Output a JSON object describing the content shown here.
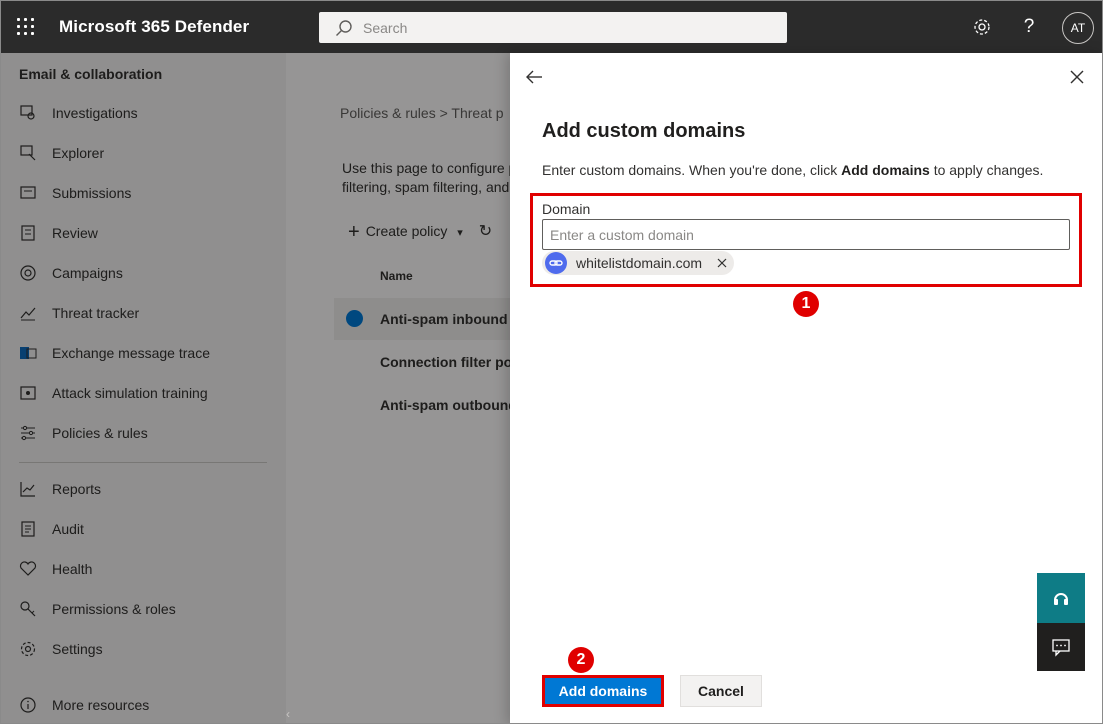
{
  "app": {
    "title": "Microsoft 365 Defender",
    "user_initials": "AT"
  },
  "search": {
    "placeholder": "Search"
  },
  "topbar_icons": [
    "waffle-icon",
    "gear-icon",
    "help-icon"
  ],
  "sidebar": {
    "section": "Email & collaboration",
    "items": [
      {
        "label": "Investigations",
        "icon": "investigations-icon"
      },
      {
        "label": "Explorer",
        "icon": "explorer-icon"
      },
      {
        "label": "Submissions",
        "icon": "submissions-icon"
      },
      {
        "label": "Review",
        "icon": "review-icon"
      },
      {
        "label": "Campaigns",
        "icon": "campaigns-icon"
      },
      {
        "label": "Threat tracker",
        "icon": "threat-tracker-icon"
      },
      {
        "label": "Exchange message trace",
        "icon": "exchange-icon"
      },
      {
        "label": "Attack simulation training",
        "icon": "attack-simulation-icon"
      },
      {
        "label": "Policies & rules",
        "icon": "policies-icon"
      },
      {
        "label": "Reports",
        "icon": "reports-icon"
      },
      {
        "label": "Audit",
        "icon": "audit-icon"
      },
      {
        "label": "Health",
        "icon": "health-icon"
      },
      {
        "label": "Permissions & roles",
        "icon": "permissions-icon"
      },
      {
        "label": "Settings",
        "icon": "settings-icon"
      },
      {
        "label": "More resources",
        "icon": "info-icon"
      }
    ]
  },
  "background": {
    "breadcrumb": "Policies & rules  >  Threat p",
    "description_line1": "Use this page to configure p",
    "description_line2": "filtering, spam filtering, and",
    "create_policy": "Create policy",
    "column_name": "Name",
    "rows": [
      "Anti-spam inbound p",
      "Connection filter pol",
      "Anti-spam outbound"
    ]
  },
  "panel": {
    "title": "Add custom domains",
    "desc_prefix": "Enter custom domains. When you're done, click ",
    "desc_bold": "Add domains",
    "desc_suffix": " to apply changes.",
    "field_label": "Domain",
    "field_placeholder": "Enter a custom domain",
    "field_value": "",
    "chip_text": "whitelistdomain.com",
    "badge1": "1",
    "badge2": "2",
    "primary_button": "Add domains",
    "secondary_button": "Cancel"
  },
  "colors": {
    "topbar": "#2b2b2b",
    "primary": "#0078d4",
    "annotation_red": "#e00000",
    "help_teal": "#0e7c86"
  }
}
